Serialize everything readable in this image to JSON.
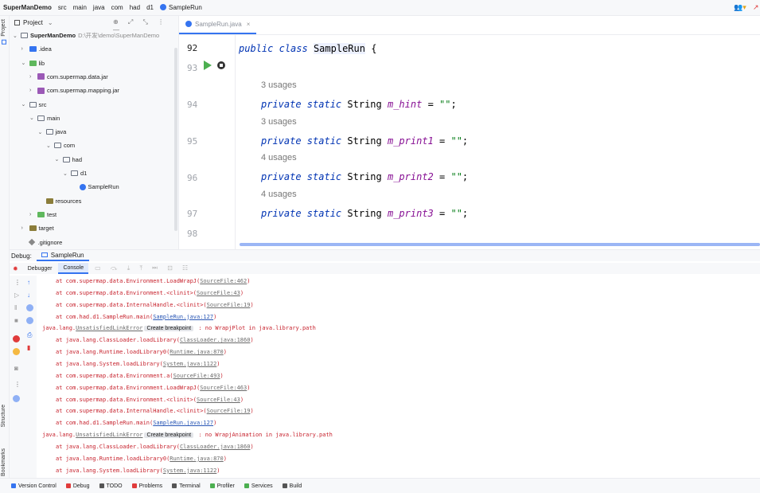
{
  "breadcrumb": [
    "SuperManDemo",
    "src",
    "main",
    "java",
    "com",
    "had",
    "d1",
    "SampleRun"
  ],
  "left_strip": {
    "project": "Project",
    "structure": "Structure",
    "bookmarks": "Bookmarks"
  },
  "project_panel": {
    "title": "Project",
    "tools": "⊕ ⤢ ⤡ ⋮ —",
    "tree": [
      {
        "label": "SuperManDemo",
        "extra": "D:\\开发\\demo\\SuperManDemo",
        "icon": "folder",
        "level": 0,
        "arrow": "⌄",
        "bold": true
      },
      {
        "label": ".idea",
        "icon": "folder-blue",
        "level": 1,
        "arrow": "›"
      },
      {
        "label": "lib",
        "icon": "folder-green",
        "level": 1,
        "arrow": "⌄"
      },
      {
        "label": "com.supermap.data.jar",
        "icon": "jar",
        "level": 2,
        "arrow": "›"
      },
      {
        "label": "com.supermap.mapping.jar",
        "icon": "jar",
        "level": 2,
        "arrow": "›"
      },
      {
        "label": "src",
        "icon": "folder",
        "level": 1,
        "arrow": "⌄"
      },
      {
        "label": "main",
        "icon": "folder",
        "level": 2,
        "arrow": "⌄"
      },
      {
        "label": "java",
        "icon": "folder",
        "level": 3,
        "arrow": "⌄"
      },
      {
        "label": "com",
        "icon": "folder",
        "level": 4,
        "arrow": "⌄"
      },
      {
        "label": "had",
        "icon": "folder",
        "level": 5,
        "arrow": "⌄"
      },
      {
        "label": "d1",
        "icon": "folder",
        "level": 6,
        "arrow": "⌄"
      },
      {
        "label": "SampleRun",
        "icon": "java",
        "level": 7,
        "arrow": ""
      },
      {
        "label": "resources",
        "icon": "folder-olive",
        "level": 3,
        "arrow": ""
      },
      {
        "label": "test",
        "icon": "folder-green",
        "level": 2,
        "arrow": "›"
      },
      {
        "label": "target",
        "icon": "folder-olive",
        "level": 1,
        "arrow": "›"
      },
      {
        "label": ".gitignore",
        "icon": "git",
        "level": 1,
        "arrow": ""
      }
    ]
  },
  "editor": {
    "tab_label": "SampleRun.java",
    "tab_close": "×",
    "line_numbers": [
      "92",
      "93",
      "94",
      "95",
      "96",
      "97",
      "98"
    ],
    "usages": [
      "3 usages",
      "3 usages",
      "4 usages",
      "4 usages"
    ],
    "class_decl": {
      "kw1": "public",
      "kw2": "class",
      "name": "SampleRun",
      "brace": "{"
    },
    "fields": [
      {
        "mods": "private static",
        "type": "String",
        "name": "m_hint",
        "eq": " = ",
        "value": "\"\"",
        "semi": ";"
      },
      {
        "mods": "private static",
        "type": "String",
        "name": "m_print1",
        "eq": " = ",
        "value": "\"\"",
        "semi": ";"
      },
      {
        "mods": "private static",
        "type": "String",
        "name": "m_print2",
        "eq": " = ",
        "value": "\"\"",
        "semi": ";"
      },
      {
        "mods": "private static",
        "type": "String",
        "name": "m_print3",
        "eq": " = ",
        "value": "\"\"",
        "semi": ";"
      }
    ]
  },
  "debug": {
    "label": "Debug:",
    "config": "SampleRun",
    "tabs": [
      "Debugger",
      "Console"
    ],
    "console_lines": [
      {
        "pre": "at com.supermap.data.Environment.LoadWrapJ(",
        "link": "SourceFile:462",
        "post": ")",
        "kind": "grey"
      },
      {
        "pre": "at com.supermap.data.Environment.<clinit>(",
        "link": "SourceFile:43",
        "post": ")",
        "kind": "grey"
      },
      {
        "pre": "at com.supermap.data.InternalHandle.<clinit>(",
        "link": "SourceFile:19",
        "post": ")",
        "kind": "grey"
      },
      {
        "pre": "at com.had.d1.SampleRun.main(",
        "link": "SampleRun.java:127",
        "post": ")",
        "kind": "blue"
      },
      {
        "pre": "java.lang.",
        "link": "UnsatisfiedLinkError",
        "bp": "Create breakpoint",
        "post": " : no WrapjPlot in java.library.path",
        "kind": "error"
      },
      {
        "pre": "at java.lang.ClassLoader.loadLibrary(",
        "link": "ClassLoader.java:1860",
        "post": ")",
        "kind": "grey"
      },
      {
        "pre": "at java.lang.Runtime.loadLibrary0(",
        "link": "Runtime.java:870",
        "post": ")",
        "kind": "grey"
      },
      {
        "pre": "at java.lang.System.loadLibrary(",
        "link": "System.java:1122",
        "post": ")",
        "kind": "grey"
      },
      {
        "pre": "at com.supermap.data.Environment.a(",
        "link": "SourceFile:493",
        "post": ")",
        "kind": "grey"
      },
      {
        "pre": "at com.supermap.data.Environment.LoadWrapJ(",
        "link": "SourceFile:463",
        "post": ")",
        "kind": "grey"
      },
      {
        "pre": "at com.supermap.data.Environment.<clinit>(",
        "link": "SourceFile:43",
        "post": ")",
        "kind": "grey"
      },
      {
        "pre": "at com.supermap.data.InternalHandle.<clinit>(",
        "link": "SourceFile:19",
        "post": ")",
        "kind": "grey"
      },
      {
        "pre": "at com.had.d1.SampleRun.main(",
        "link": "SampleRun.java:127",
        "post": ")",
        "kind": "blue"
      },
      {
        "pre": "java.lang.",
        "link": "UnsatisfiedLinkError",
        "bp": "Create breakpoint",
        "post": " : no WrapjAnimation in java.library.path",
        "kind": "error"
      },
      {
        "pre": "at java.lang.ClassLoader.loadLibrary(",
        "link": "ClassLoader.java:1860",
        "post": ")",
        "kind": "grey"
      },
      {
        "pre": "at java.lang.Runtime.loadLibrary0(",
        "link": "Runtime.java:870",
        "post": ")",
        "kind": "grey"
      },
      {
        "pre": "at java.lang.System.loadLibrary(",
        "link": "System.java:1122",
        "post": ")",
        "kind": "grey"
      }
    ]
  },
  "statusbar": [
    {
      "label": "Version Control",
      "color": "#3574f0"
    },
    {
      "label": "Debug",
      "color": "#e03b3b"
    },
    {
      "label": "TODO",
      "color": "#555555"
    },
    {
      "label": "Problems",
      "color": "#e03b3b"
    },
    {
      "label": "Terminal",
      "color": "#555555"
    },
    {
      "label": "Profiler",
      "color": "#4caf50"
    },
    {
      "label": "Services",
      "color": "#4caf50"
    },
    {
      "label": "Build",
      "color": "#555555"
    }
  ],
  "colors": {
    "accent": "#3574f0",
    "error": "#c7222d",
    "keyword": "#0033b3",
    "string": "#067d17"
  }
}
